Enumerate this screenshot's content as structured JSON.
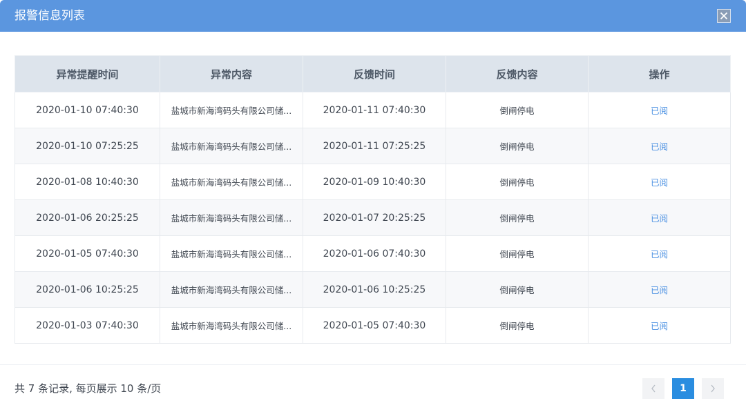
{
  "dialog": {
    "title": "报警信息列表",
    "close_icon": "close-icon"
  },
  "table": {
    "columns": [
      "异常提醒时间",
      "异常内容",
      "反馈时间",
      "反馈内容",
      "操作"
    ],
    "rows": [
      {
        "alert_time": "2020-01-10 07:40:30",
        "content": "盐城市新海湾码头有限公司储...",
        "feedback_time": "2020-01-11 07:40:30",
        "feedback": "倒闸停电",
        "action": "已阅"
      },
      {
        "alert_time": "2020-01-10 07:25:25",
        "content": "盐城市新海湾码头有限公司储...",
        "feedback_time": "2020-01-11 07:25:25",
        "feedback": "倒闸停电",
        "action": "已阅"
      },
      {
        "alert_time": "2020-01-08 10:40:30",
        "content": "盐城市新海湾码头有限公司储...",
        "feedback_time": "2020-01-09 10:40:30",
        "feedback": "倒闸停电",
        "action": "已阅"
      },
      {
        "alert_time": "2020-01-06 20:25:25",
        "content": "盐城市新海湾码头有限公司储...",
        "feedback_time": "2020-01-07 20:25:25",
        "feedback": "倒闸停电",
        "action": "已阅"
      },
      {
        "alert_time": "2020-01-05 07:40:30",
        "content": "盐城市新海湾码头有限公司储...",
        "feedback_time": "2020-01-06 07:40:30",
        "feedback": "倒闸停电",
        "action": "已阅"
      },
      {
        "alert_time": "2020-01-06 10:25:25",
        "content": "盐城市新海湾码头有限公司储...",
        "feedback_time": "2020-01-06 10:25:25",
        "feedback": "倒闸停电",
        "action": "已阅"
      },
      {
        "alert_time": "2020-01-03 07:40:30",
        "content": "盐城市新海湾码头有限公司储...",
        "feedback_time": "2020-01-05 07:40:30",
        "feedback": "倒闸停电",
        "action": "已阅"
      }
    ]
  },
  "footer": {
    "summary": "共 7 条记录, 每页展示 10 条/页",
    "pagination": {
      "prev_icon": "chevron-left-icon",
      "current_page": "1",
      "next_icon": "chevron-right-icon"
    }
  },
  "colors": {
    "header_bg": "#5b96df",
    "table_head_bg": "#dde4ec",
    "link": "#4a90e2",
    "page_active": "#2a8de0"
  }
}
